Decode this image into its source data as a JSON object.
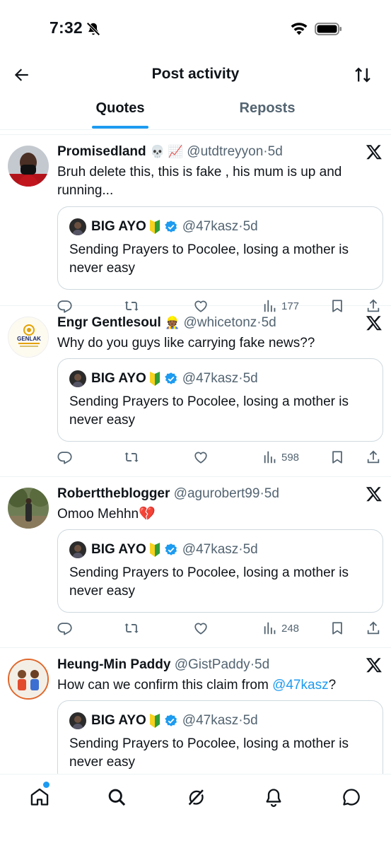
{
  "status_bar": {
    "time": "7:32"
  },
  "header": {
    "title": "Post activity"
  },
  "tabs": [
    {
      "label": "Quotes",
      "active": true
    },
    {
      "label": "Reposts",
      "active": false
    }
  ],
  "colors": {
    "accent": "#1d9bf0",
    "text": "#0f1419",
    "muted": "#536471",
    "border": "#cfd9de"
  },
  "quoted_post": {
    "name": "BIG AYO",
    "handle": "@47kasz",
    "dot": "·",
    "time": "5d",
    "text": "Sending Prayers to Pocolee, losing a mother is never easy"
  },
  "posts": [
    {
      "name": "Promisedland",
      "emoji": "💀 📈",
      "handle": "@utdtreyyon",
      "dot": "·",
      "time": "5d",
      "text": "Bruh delete this, this is fake , his mum is up and running...",
      "views": "177"
    },
    {
      "name": "Engr Gentlesoul",
      "emoji": "👷🏾",
      "handle": "@whicetonz",
      "dot": "·",
      "time": "5d",
      "text": "Why do you guys like carrying fake news??",
      "views": "598"
    },
    {
      "name": "Roberttheblogger",
      "emoji": "",
      "handle": "@agurobert99",
      "dot": "·",
      "time": "5d",
      "text": "Omoo Mehhn💔",
      "views": "248"
    },
    {
      "name": "Heung-Min Paddy",
      "emoji": "",
      "handle": "@GistPaddy",
      "dot": "·",
      "time": "5d",
      "text_prefix": "How can we confirm this claim from ",
      "text_mention": "@47kasz",
      "text_suffix": "?",
      "views": ""
    }
  ],
  "avatar_texts": {
    "genlak": "GENLAK"
  },
  "bottom_nav": [
    "home-icon",
    "search-icon",
    "grok-icon",
    "notifications-icon",
    "messages-icon"
  ]
}
